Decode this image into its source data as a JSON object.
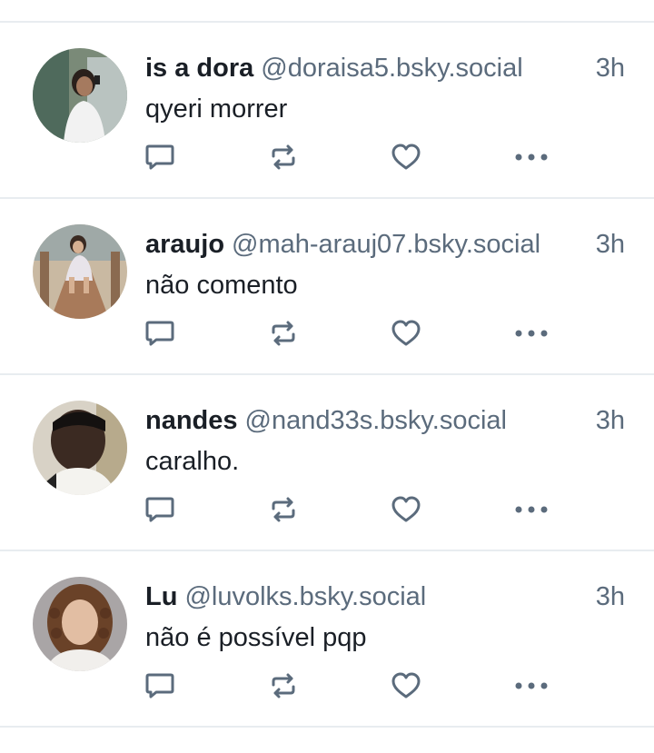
{
  "colors": {
    "text_primary": "#1a1f26",
    "text_secondary": "#5b6b7c",
    "icon": "#5b6b7c",
    "divider": "#e8ecf0",
    "background": "#ffffff"
  },
  "posts": [
    {
      "display_name": "is a dora",
      "handle": "@doraisa5.bsky.social",
      "time": "3h",
      "text": "qyeri morrer",
      "avatar_icon": "profile-photo"
    },
    {
      "display_name": "araujo",
      "handle": "@mah-arauj07.bsky.social",
      "time": "3h",
      "text": "não comento",
      "avatar_icon": "profile-photo"
    },
    {
      "display_name": "nandes",
      "handle": "@nand33s.bsky.social",
      "time": "3h",
      "text": "caralho.",
      "avatar_icon": "profile-photo"
    },
    {
      "display_name": "Lu",
      "handle": "@luvolks.bsky.social",
      "time": "3h",
      "text": "não é possível pqp",
      "avatar_icon": "profile-photo"
    }
  ],
  "action_icons": [
    "reply-icon",
    "repost-icon",
    "like-icon",
    "more-options-icon"
  ]
}
